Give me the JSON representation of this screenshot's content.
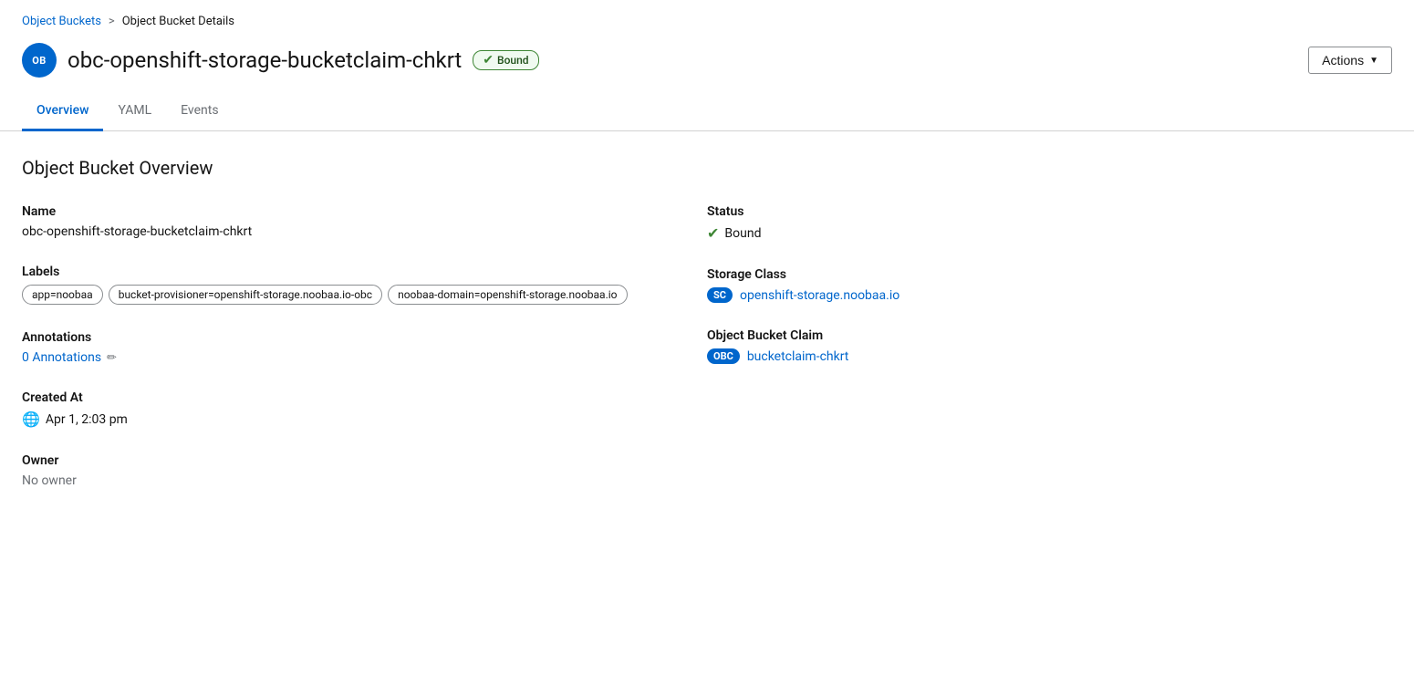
{
  "breadcrumb": {
    "parent_label": "Object Buckets",
    "separator": ">",
    "current_label": "Object Bucket Details"
  },
  "header": {
    "badge_text": "OB",
    "title": "obc-openshift-storage-bucketclaim-chkrt",
    "status_text": "Bound",
    "actions_label": "Actions"
  },
  "tabs": [
    {
      "id": "overview",
      "label": "Overview",
      "active": true
    },
    {
      "id": "yaml",
      "label": "YAML",
      "active": false
    },
    {
      "id": "events",
      "label": "Events",
      "active": false
    }
  ],
  "overview": {
    "section_title": "Object Bucket Overview",
    "left": {
      "name_label": "Name",
      "name_value": "obc-openshift-storage-bucketclaim-chkrt",
      "labels_label": "Labels",
      "labels": [
        "app=noobaa",
        "bucket-provisioner=openshift-storage.noobaa.io-obc",
        "noobaa-domain=openshift-storage.noobaa.io"
      ],
      "annotations_label": "Annotations",
      "annotations_link": "0 Annotations",
      "edit_icon": "✏",
      "created_at_label": "Created At",
      "created_at_icon": "🌐",
      "created_at_value": "Apr 1, 2:03 pm",
      "owner_label": "Owner",
      "owner_value": "No owner"
    },
    "right": {
      "status_label": "Status",
      "status_check": "✔",
      "status_value": "Bound",
      "storage_class_label": "Storage Class",
      "sc_badge": "SC",
      "storage_class_link": "openshift-storage.noobaa.io",
      "obc_label": "Object Bucket Claim",
      "obc_badge": "OBC",
      "obc_link": "bucketclaim-chkrt"
    }
  }
}
